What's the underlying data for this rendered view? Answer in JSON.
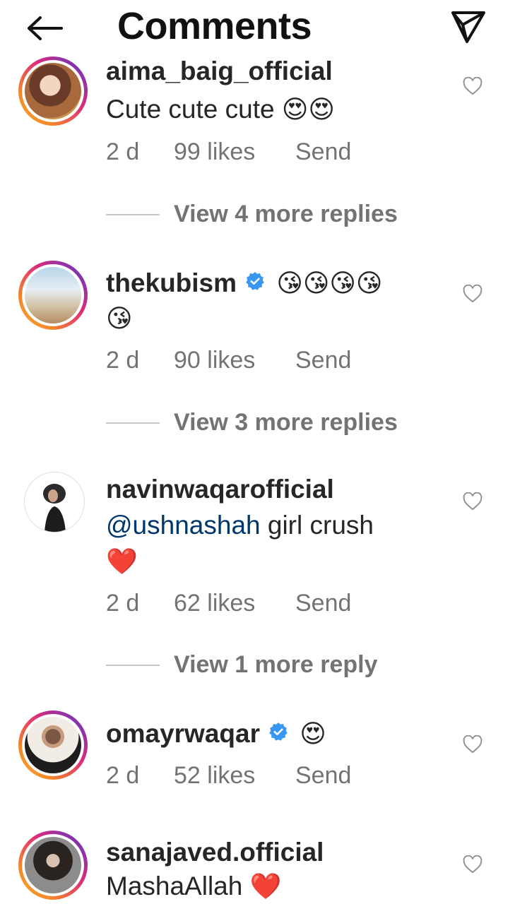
{
  "header": {
    "title": "Comments",
    "back_icon": "arrow-left-icon",
    "share_icon": "paper-plane-icon"
  },
  "colors": {
    "text": "#262626",
    "secondary": "#737373",
    "mention": "#00376b",
    "verified": "#3897f0",
    "heart_red": "#ed4956"
  },
  "comments": [
    {
      "username": "aima_baig_official",
      "text": "Cute cute cute",
      "emoji": "😍😍",
      "time": "2 d",
      "likes": "99 likes",
      "send": "Send",
      "replies": "View 4 more replies"
    },
    {
      "username": "thekubism",
      "verified": true,
      "emoji": "😘😘😘😘",
      "emoji_line2": "😘",
      "time": "2 d",
      "likes": "90 likes",
      "send": "Send",
      "replies": "View 3 more replies"
    },
    {
      "username": "navinwaqarofficial",
      "mention": "@ushnashah",
      "text": " girl crush",
      "emoji": "❤️",
      "time": "2 d",
      "likes": "62 likes",
      "send": "Send",
      "replies": "View 1 more reply"
    },
    {
      "username": "omayrwaqar",
      "verified": true,
      "emoji": "😍",
      "time": "2 d",
      "likes": "52 likes",
      "send": "Send"
    },
    {
      "username": "sanajaved.official",
      "text": "MashaAllah",
      "emoji": "❤️"
    }
  ]
}
